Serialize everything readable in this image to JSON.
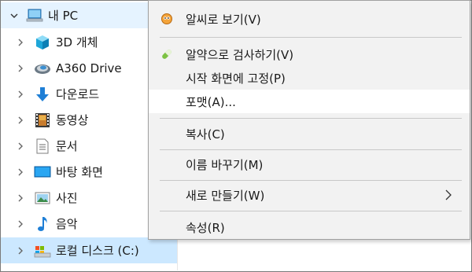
{
  "nav": {
    "items": [
      {
        "label": "내 PC",
        "icon": "pc-icon",
        "expanded": true
      },
      {
        "label": "3D 개체",
        "icon": "3d-objects-icon"
      },
      {
        "label": "A360 Drive",
        "icon": "a360-drive-icon"
      },
      {
        "label": "다운로드",
        "icon": "download-icon"
      },
      {
        "label": "동영상",
        "icon": "video-icon"
      },
      {
        "label": "문서",
        "icon": "document-icon"
      },
      {
        "label": "바탕 화면",
        "icon": "desktop-icon"
      },
      {
        "label": "사진",
        "icon": "pictures-icon"
      },
      {
        "label": "음악",
        "icon": "music-icon"
      },
      {
        "label": "로컬 디스크 (C:)",
        "icon": "local-disk-icon",
        "selected": true
      }
    ]
  },
  "menu": {
    "items": [
      {
        "label": "알씨로 보기(V)",
        "icon": "alsee-icon"
      },
      {
        "label": "알약으로 검사하기(V)",
        "icon": "alyac-icon"
      },
      {
        "label": "시작 화면에 고정(P)"
      },
      {
        "label": "포맷(A)...",
        "hover": true
      },
      {
        "label": "복사(C)"
      },
      {
        "label": "이름 바꾸기(M)"
      },
      {
        "label": "새로 만들기(W)",
        "submenu": true
      },
      {
        "label": "속성(R)"
      }
    ]
  },
  "colors": {
    "selected_bg": "#cce8ff",
    "pc_row_bg": "#e5f3ff",
    "menu_bg": "#f2f2f2",
    "menu_hover_bg": "#ffffff"
  }
}
